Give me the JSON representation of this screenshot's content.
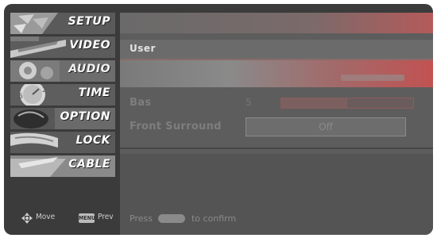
{
  "menu": {
    "items": [
      {
        "label": "SETUP",
        "name": "setup",
        "active": false
      },
      {
        "label": "VIDEO",
        "name": "video",
        "active": false
      },
      {
        "label": "AUDIO",
        "name": "audio",
        "active": true
      },
      {
        "label": "TIME",
        "name": "time",
        "active": false
      },
      {
        "label": "OPTION",
        "name": "option",
        "active": false
      },
      {
        "label": "LOCK",
        "name": "lock",
        "active": false
      },
      {
        "label": "CABLE",
        "name": "cable",
        "active": false
      }
    ],
    "footer": {
      "move_label": "Move",
      "prev_button": "MENU",
      "prev_label": "Prev"
    }
  },
  "panel": {
    "title": "User",
    "fields": {
      "bass": {
        "label": "Bas",
        "value": "5",
        "level": 0.5
      },
      "surround": {
        "label": "Front Surround",
        "value": "Off"
      }
    },
    "hint": {
      "before": "Press",
      "after": "to confirm"
    }
  }
}
